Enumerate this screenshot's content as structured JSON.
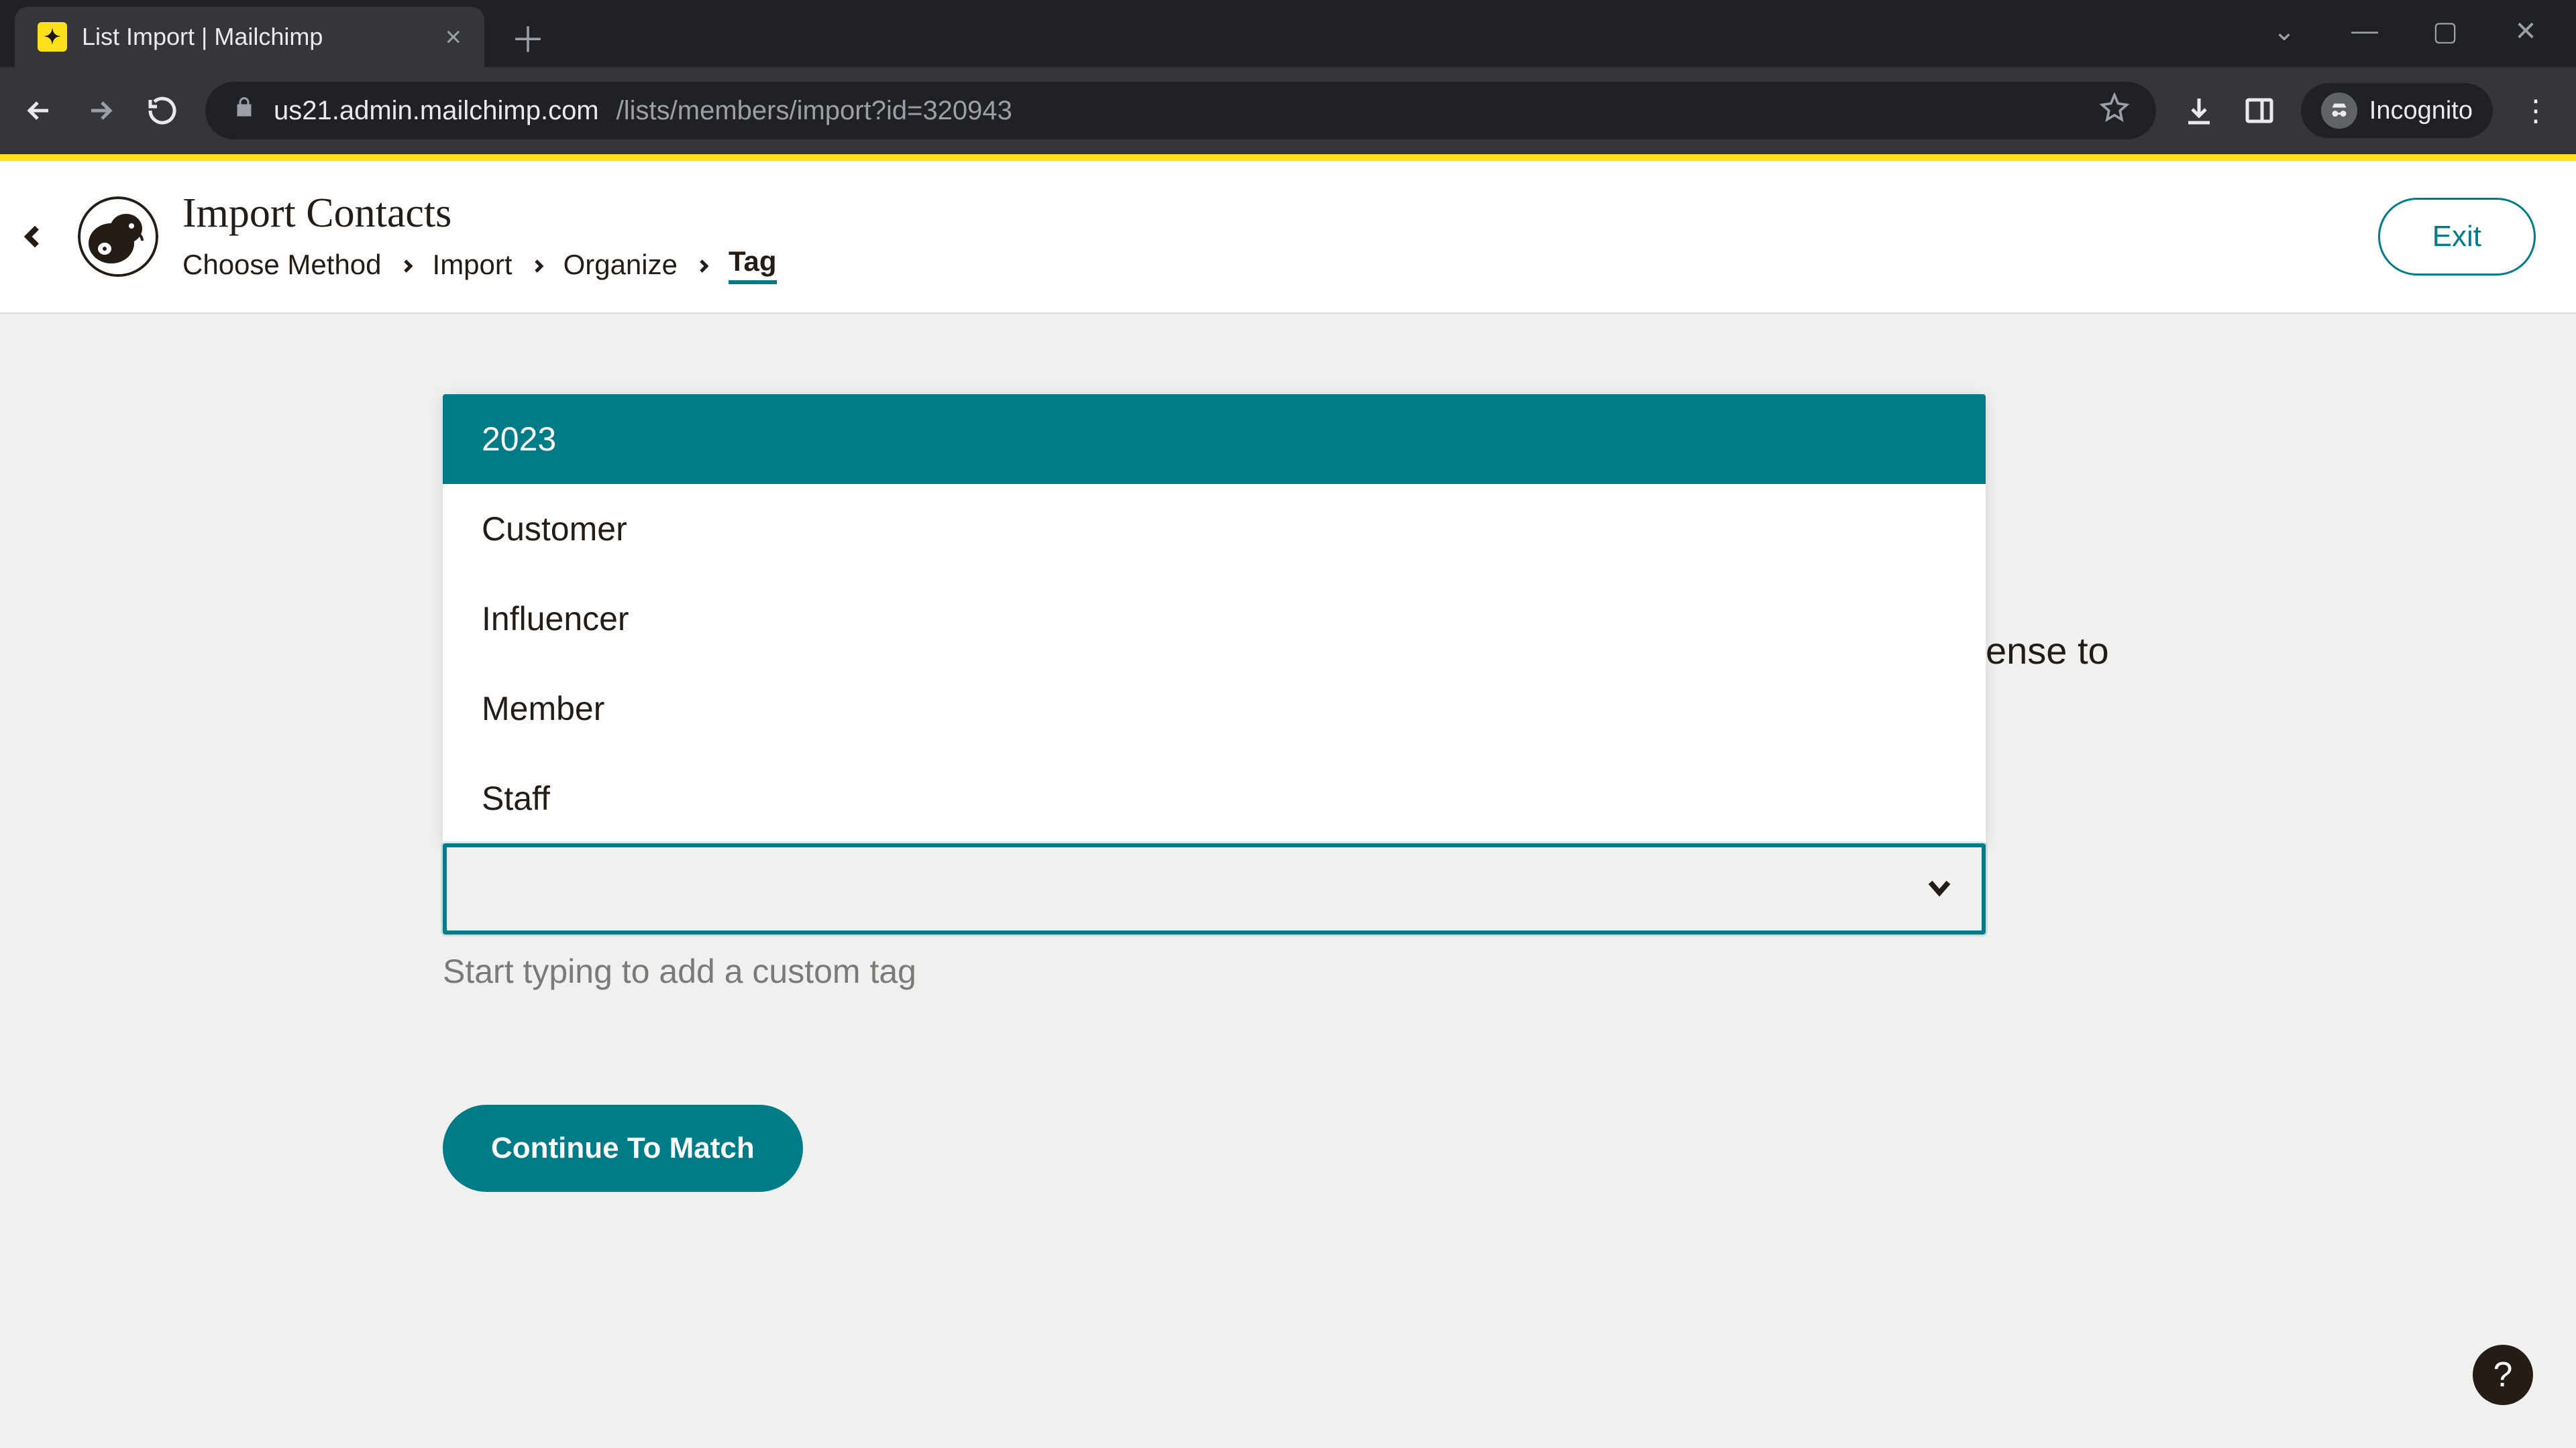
{
  "browser": {
    "tab_title": "List Import | Mailchimp",
    "url_host": "us21.admin.mailchimp.com",
    "url_path": "/lists/members/import?id=320943",
    "incognito_label": "Incognito"
  },
  "header": {
    "page_title": "Import Contacts",
    "breadcrumbs": [
      "Choose Method",
      "Import",
      "Organize",
      "Tag"
    ],
    "active_breadcrumb_index": 3,
    "exit_label": "Exit"
  },
  "dropdown": {
    "options": [
      "2023",
      "Customer",
      "Influencer",
      "Member",
      "Staff"
    ],
    "highlighted_index": 0,
    "input_value": "",
    "helper_text": "Start typing to add a custom tag"
  },
  "background_hint_fragment": "ense to",
  "continue_label": "Continue To Match",
  "help_label": "?",
  "colors": {
    "brand_yellow": "#ffe01b",
    "teal": "#007c89",
    "page_bg": "#f0f0ee",
    "text": "#241c15"
  }
}
